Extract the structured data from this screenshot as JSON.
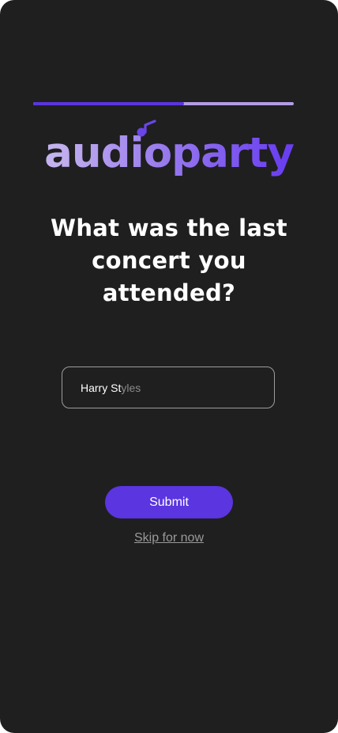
{
  "app": {
    "logo_text": "audioparty",
    "logo_icon": "music-note-icon"
  },
  "progress": {
    "value": 0.58
  },
  "question": {
    "text": "What was the last concert you attended?"
  },
  "answer": {
    "typed": "Harry St",
    "autocomplete": "yles"
  },
  "actions": {
    "submit_label": "Submit",
    "skip_label": "Skip for now"
  },
  "colors": {
    "accent": "#5a35e0",
    "accent_light": "#b39ce6",
    "background": "#1f1f1f"
  }
}
